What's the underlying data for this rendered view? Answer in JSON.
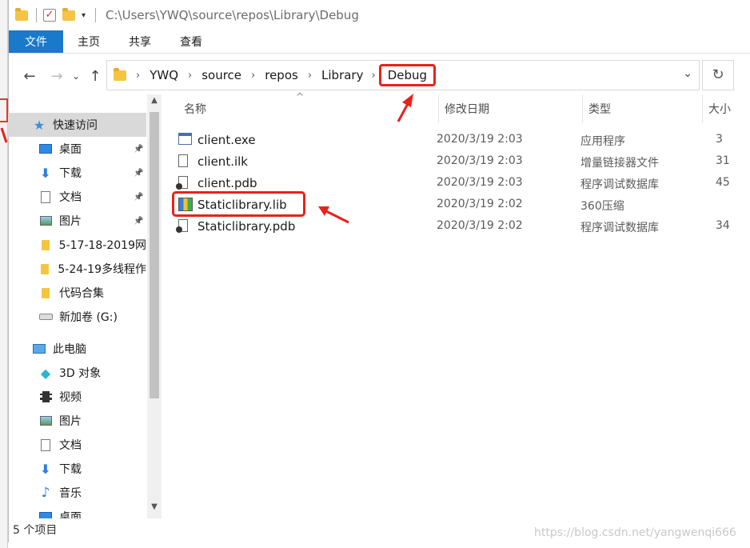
{
  "titlebar": {
    "path": "C:\\Users\\YWQ\\source\\repos\\Library\\Debug"
  },
  "ribbon": {
    "tabs": [
      "文件",
      "主页",
      "共享",
      "查看"
    ]
  },
  "address": {
    "crumbs": [
      "YWQ",
      "source",
      "repos",
      "Library",
      "Debug"
    ]
  },
  "sidebar": {
    "items": [
      {
        "label": "快速访问",
        "icon": "star-icon",
        "pinned": false
      },
      {
        "label": "桌面",
        "icon": "desktop-icon",
        "pinned": true
      },
      {
        "label": "下载",
        "icon": "download-icon",
        "pinned": true
      },
      {
        "label": "文档",
        "icon": "document-icon",
        "pinned": true
      },
      {
        "label": "图片",
        "icon": "picture-icon",
        "pinned": true
      },
      {
        "label": "5-17-18-2019网",
        "icon": "folder-icon",
        "pinned": false
      },
      {
        "label": "5-24-19多线程作",
        "icon": "folder-icon",
        "pinned": false
      },
      {
        "label": "代码合集",
        "icon": "folder-icon",
        "pinned": false
      },
      {
        "label": "新加卷 (G:)",
        "icon": "drive-icon",
        "pinned": false
      },
      {
        "label": "此电脑",
        "icon": "computer-icon",
        "pinned": false
      },
      {
        "label": "3D 对象",
        "icon": "cube-icon",
        "pinned": false
      },
      {
        "label": "视频",
        "icon": "video-icon",
        "pinned": false
      },
      {
        "label": "图片",
        "icon": "picture-icon",
        "pinned": false
      },
      {
        "label": "文档",
        "icon": "document-icon",
        "pinned": false
      },
      {
        "label": "下载",
        "icon": "download-icon",
        "pinned": false
      },
      {
        "label": "音乐",
        "icon": "music-icon",
        "pinned": false
      },
      {
        "label": "桌面",
        "icon": "desktop-icon",
        "pinned": false
      }
    ]
  },
  "columns": {
    "name": "名称",
    "date": "修改日期",
    "type": "类型",
    "size": "大小"
  },
  "files": [
    {
      "name": "client.exe",
      "date": "2020/3/19 2:03",
      "type": "应用程序",
      "size": "3",
      "icon": "exe-icon"
    },
    {
      "name": "client.ilk",
      "date": "2020/3/19 2:03",
      "type": "增量链接器文件",
      "size": "31",
      "icon": "file-icon"
    },
    {
      "name": "client.pdb",
      "date": "2020/3/19 2:03",
      "type": "程序调试数据库",
      "size": "45",
      "icon": "pdb-icon"
    },
    {
      "name": "Staticlibrary.lib",
      "date": "2020/3/19 2:02",
      "type": "360压缩",
      "size": "",
      "icon": "archive-icon"
    },
    {
      "name": "Staticlibrary.pdb",
      "date": "2020/3/19 2:02",
      "type": "程序调试数据库",
      "size": "34",
      "icon": "pdb-icon"
    }
  ],
  "status": {
    "count": "5 个项目"
  },
  "watermark": "https://blog.csdn.net/yangwenqi666",
  "colors": {
    "accent": "#1979ca",
    "highlight": "#e8221c"
  }
}
